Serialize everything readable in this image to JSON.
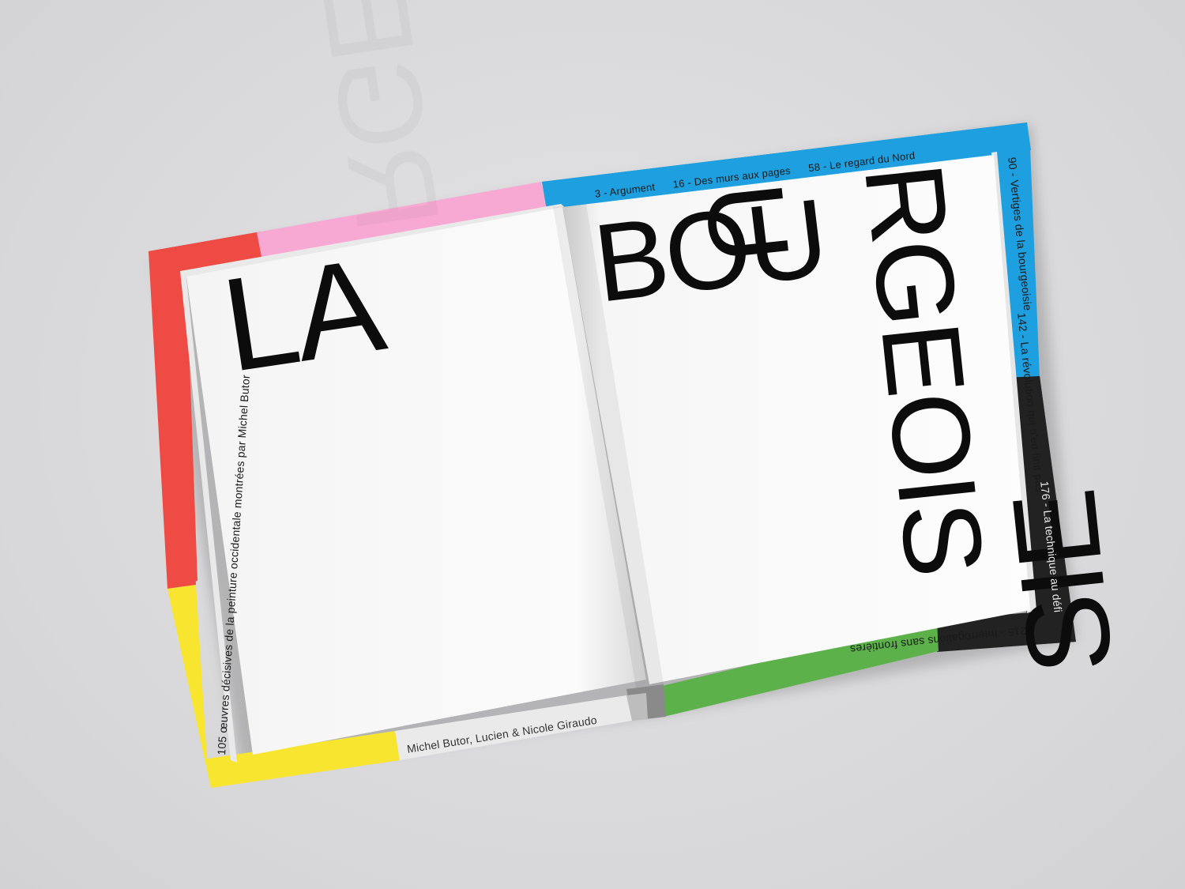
{
  "colors": {
    "background": "#dcdcde",
    "red": "#ee4b45",
    "pink": "#f7a9d3",
    "blue": "#1e9fe0",
    "black": "#222222",
    "green": "#5cb14b",
    "yellow": "#f7e52f",
    "page": "#fbfbfb"
  },
  "book": {
    "left_page": {
      "title": "LA"
    },
    "right_page": {
      "title_horizontal": "BOU",
      "title_vertical_1": "RGEOIS",
      "title_vertical_2": "U",
      "title_bottom": "SIE"
    },
    "cover": {
      "subtitle": "105 œuvres décisives de la peinture occidentale montrées par Michel Butor",
      "authors": "Michel Butor, Lucien & Nicole Giraudo",
      "contents_top": "3 - Argument      16 - Des murs aux pages      58 - Le regard du Nord",
      "contents_right_1": "90 - Vertiges de la bourgeoisie",
      "contents_right_2": "142 - La révolution qui n'en finit pas",
      "contents_right_3": "176 - La technique au défi",
      "contents_bottom": "215 - Interrogations sans frontières"
    }
  }
}
